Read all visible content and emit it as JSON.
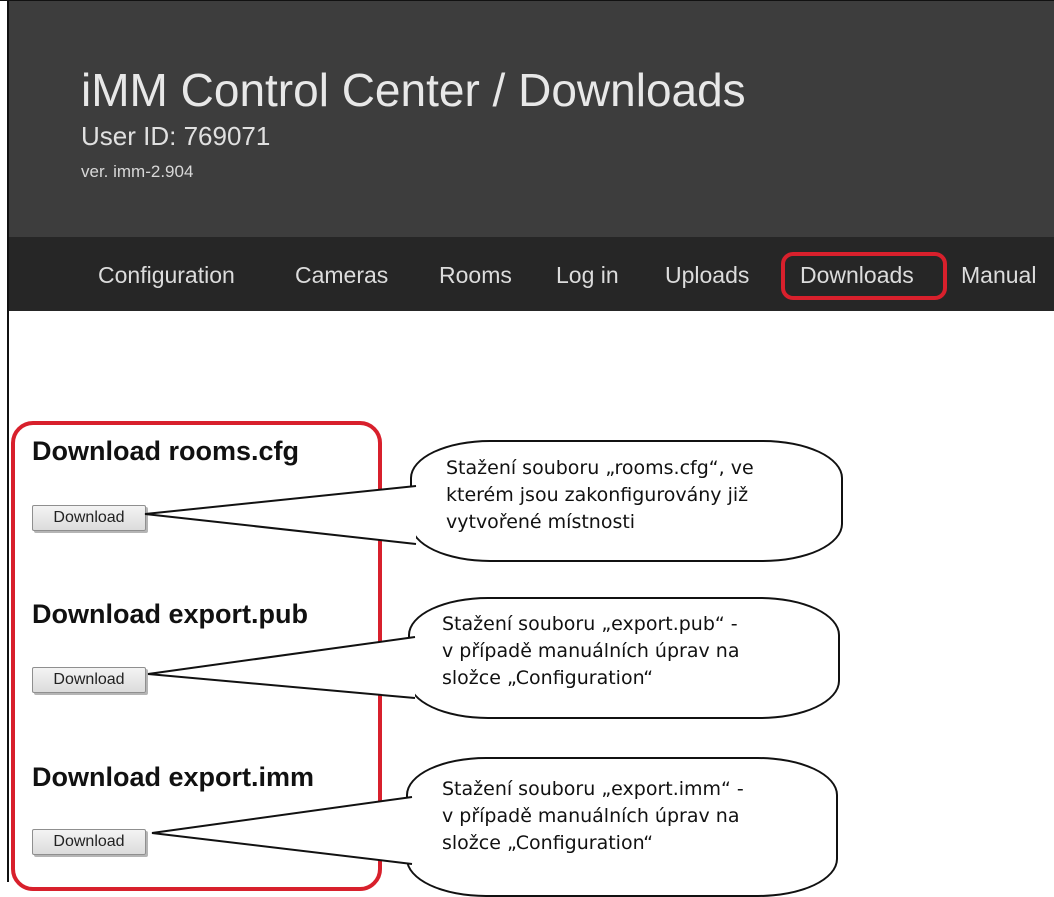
{
  "header": {
    "title": "iMM Control Center / Downloads",
    "user_id": "User ID: 769071",
    "version": "ver. imm-2.904"
  },
  "nav": {
    "items": [
      "Configuration",
      "Cameras",
      "Rooms",
      "Log in",
      "Uploads",
      "Downloads",
      "Manual"
    ],
    "active": "Downloads"
  },
  "sections": [
    {
      "title": "Download rooms.cfg",
      "button_label": "Download"
    },
    {
      "title": "Download export.pub",
      "button_label": "Download"
    },
    {
      "title": "Download export.imm",
      "button_label": "Download"
    }
  ],
  "callouts": [
    {
      "lines": [
        "Stažení souboru „rooms.cfg“, ve",
        "kterém jsou zakonfigurovány již",
        "vytvořené místnosti"
      ]
    },
    {
      "lines": [
        "Stažení souboru „export.pub“ -",
        "v případě manuálních úprav na",
        "složce „Configuration“"
      ]
    },
    {
      "lines": [
        "Stažení souboru „export.imm“ -",
        "v případě manuálních úprav na",
        "složce „Configuration“"
      ]
    }
  ],
  "colors": {
    "header_bg": "#3d3d3d",
    "navbar_bg": "#262626",
    "highlight": "#d8202c"
  }
}
